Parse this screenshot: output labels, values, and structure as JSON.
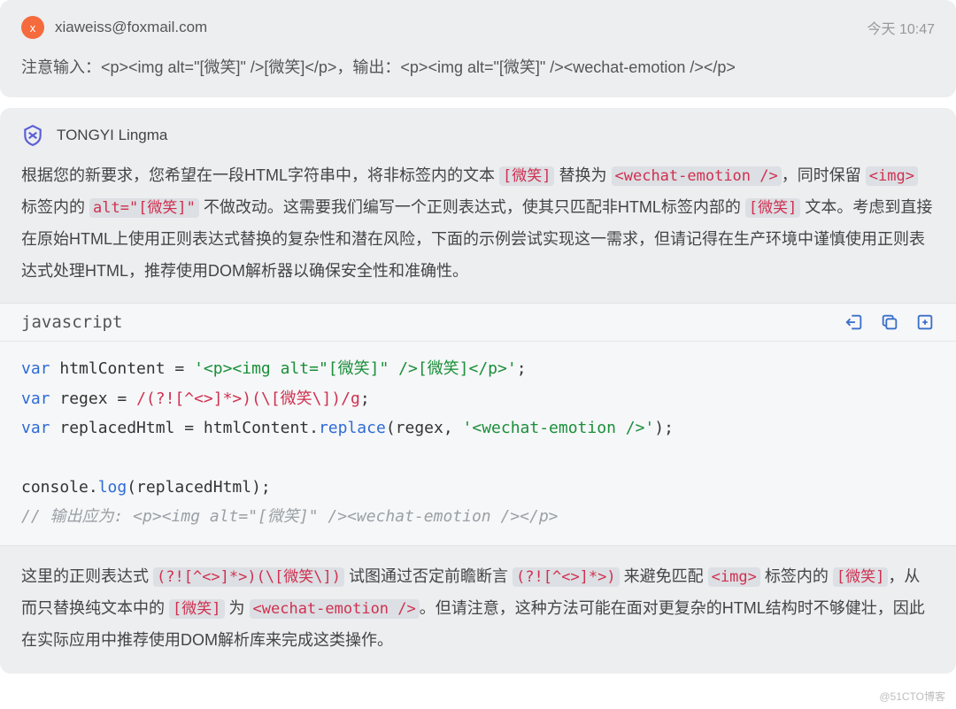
{
  "user": {
    "avatar_letter": "x",
    "email": "xiaweiss@foxmail.com",
    "timestamp": "今天 10:47",
    "message_prefix": "注意输入：",
    "input_sample": "<p><img alt=\"[微笑]\" />[微笑]</p>",
    "message_mid": "，输出：",
    "output_sample": "<p><img alt=\"[微笑]\" /><wechat-emotion /></p>"
  },
  "ai": {
    "name": "TONGYI Lingma",
    "body_part1": "根据您的新要求，您希望在一段HTML字符串中，将非标签内的文本 ",
    "token_weixiao": "[微笑]",
    "body_part2": " 替换为 ",
    "token_wechat_emotion": "<wechat-emotion />",
    "body_part3": "，同时保留 ",
    "token_img": "<img>",
    "body_part4": " 标签内的 ",
    "token_alt": "alt=\"[微笑]\"",
    "body_part5": " 不做改动。这需要我们编写一个正则表达式，使其只匹配非HTML标签内部的 ",
    "body_part6": " 文本。考虑到直接在原始HTML上使用正则表达式替换的复杂性和潜在风险，下面的示例尝试实现这一需求，但请记得在生产环境中谨慎使用正则表达式处理HTML，推荐使用DOM解析器以确保安全性和准确性。"
  },
  "code": {
    "lang": "javascript",
    "line1_kw": "var",
    "line1_var": " htmlContent = ",
    "line1_str": "'<p><img alt=\"[微笑]\" />[微笑]</p>'",
    "line2_kw": "var",
    "line2_var": " regex = ",
    "line2_re": "/(?![^<>]*>)(\\[微笑\\])/g",
    "line3_kw": "var",
    "line3_var": " replacedHtml = htmlContent.",
    "line3_mth": "replace",
    "line3_args_open": "(regex, ",
    "line3_str": "'<wechat-emotion />'",
    "line3_close": ");",
    "line5_a": "console.",
    "line5_mth": "log",
    "line5_b": "(replacedHtml);",
    "line6_comment": "// 输出应为: <p><img alt=\"[微笑]\" /><wechat-emotion /></p>"
  },
  "explain": {
    "p1": "这里的正则表达式 ",
    "regex_full": "(?![^<>]*>)(\\[微笑\\])",
    "p2": " 试图通过否定前瞻断言 ",
    "regex_neg": "(?![^<>]*>)",
    "p3": " 来避免匹配 ",
    "p4": " 标签内的 ",
    "p5": "，从而只替换纯文本中的 ",
    "p6": " 为 ",
    "p7": "。但请注意，这种方法可能在面对更复杂的HTML结构时不够健壮，因此在实际应用中推荐使用DOM解析库来完成这类操作。"
  },
  "watermark": "@51CTO博客"
}
